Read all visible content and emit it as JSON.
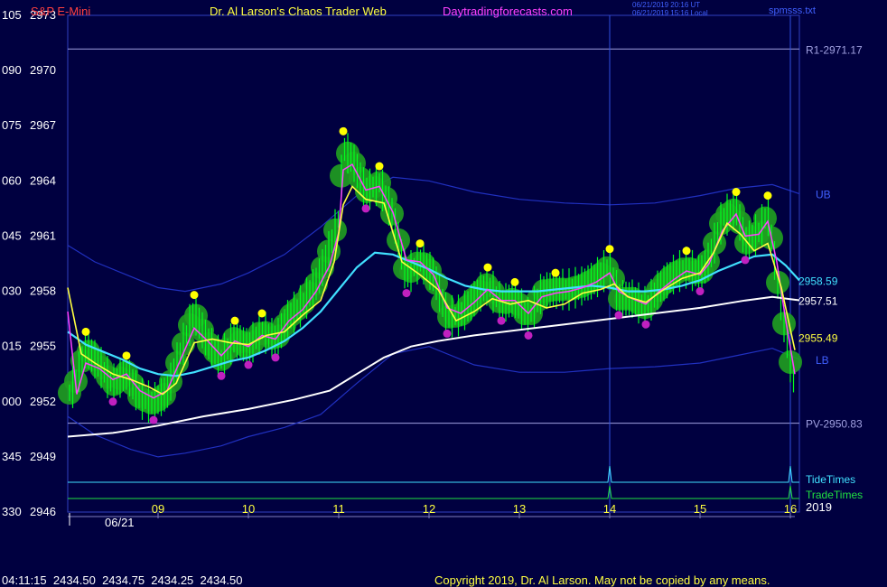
{
  "header": {
    "instrument": "S&P E-Mini",
    "site_title": "Dr. Al Larson's Chaos Trader Web",
    "site_url": "Daytradingforecasts.com",
    "timestamp_utc": "06/21/2019 20:16 UT",
    "timestamp_local": "06/21/2019 15:16 Local",
    "file_name": "spmsss.txt"
  },
  "footer": {
    "quote_line": "04:11:15  2434.50  2434.75  2434.25  2434.50",
    "copyright": "Copyright 2019, Dr. Al Larson. May not be copied by any means."
  },
  "chart_data": {
    "type": "line",
    "date_label": "06/21",
    "year_label": "2019",
    "x_ticks": [
      "09",
      "10",
      "11",
      "12",
      "13",
      "14",
      "15",
      "16"
    ],
    "y_ticks": [
      {
        "left": "105",
        "price": 2973
      },
      {
        "left": "090",
        "price": 2970
      },
      {
        "left": "075",
        "price": 2967
      },
      {
        "left": "060",
        "price": 2964
      },
      {
        "left": "045",
        "price": 2961
      },
      {
        "left": "030",
        "price": 2958
      },
      {
        "left": "015",
        "price": 2955
      },
      {
        "left": "000",
        "price": 2952
      },
      {
        "left": "345",
        "price": 2949
      },
      {
        "left": "330",
        "price": 2946
      }
    ],
    "ylim": [
      2946,
      2973
    ],
    "xlim": [
      8.0,
      16.1
    ],
    "levels": [
      {
        "label": "R1-2971.17",
        "value": 2971.17,
        "color": "#a0a0e0"
      },
      {
        "label": "PV-2950.83",
        "value": 2950.83,
        "color": "#a0a0e0"
      }
    ],
    "value_labels": [
      {
        "label": "2958.59",
        "value": 2958.59,
        "color": "#40e0ff"
      },
      {
        "label": "2957.51",
        "value": 2957.51,
        "color": "#ffffff"
      },
      {
        "label": "2955.49",
        "value": 2955.49,
        "color": "#ffff40"
      },
      {
        "label": "UB",
        "value": 2963.3,
        "color": "#4060ff"
      },
      {
        "label": "LB",
        "value": 2954.3,
        "color": "#4060ff"
      }
    ],
    "tide_times_label": "TideTimes",
    "trade_times_label": "TradeTimes",
    "time_markers": [
      14.0,
      16.0
    ],
    "colors": {
      "background": "#000040",
      "price_bars": "#00ff20",
      "glow": "#20a020",
      "avg_fast": "#ffff40",
      "avg_mid": "#ff40ff",
      "avg_cyan": "#40e0ff",
      "avg_white": "#ffffff",
      "bands": "#2030c0",
      "highs": "#ffff00",
      "lows": "#c020c0",
      "label_red": "#ff4040",
      "label_yellow": "#ffff40",
      "label_magenta": "#ff40ff"
    },
    "series": [
      {
        "name": "price",
        "x": [
          8.0,
          8.1,
          8.2,
          8.35,
          8.5,
          8.65,
          8.8,
          8.95,
          9.1,
          9.25,
          9.4,
          9.55,
          9.7,
          9.85,
          10.0,
          10.15,
          10.3,
          10.45,
          10.6,
          10.75,
          10.9,
          11.0,
          11.05,
          11.15,
          11.3,
          11.45,
          11.6,
          11.75,
          11.9,
          12.05,
          12.2,
          12.35,
          12.5,
          12.65,
          12.8,
          12.95,
          13.1,
          13.25,
          13.4,
          13.55,
          13.7,
          13.85,
          14.0,
          14.1,
          14.25,
          14.4,
          14.55,
          14.7,
          14.85,
          15.0,
          15.1,
          15.25,
          15.4,
          15.5,
          15.65,
          15.75,
          15.85,
          15.95,
          16.05
        ],
        "values": [
          2952.3,
          2953.2,
          2954.9,
          2954.0,
          2952.9,
          2953.6,
          2952.2,
          2951.9,
          2952.5,
          2954.7,
          2956.9,
          2955.2,
          2954.3,
          2955.5,
          2954.9,
          2955.9,
          2955.3,
          2956.6,
          2957.3,
          2958.4,
          2960.3,
          2962.0,
          2965.8,
          2965.2,
          2963.4,
          2963.9,
          2962.1,
          2958.8,
          2959.7,
          2958.9,
          2956.6,
          2956.7,
          2957.6,
          2958.4,
          2957.3,
          2957.6,
          2956.5,
          2958.0,
          2958.1,
          2958.1,
          2958.3,
          2958.7,
          2959.4,
          2957.6,
          2957.6,
          2957.1,
          2958.2,
          2958.9,
          2959.3,
          2958.9,
          2959.7,
          2962.0,
          2962.5,
          2960.6,
          2961.2,
          2962.3,
          2958.8,
          2955.6,
          2952.7
        ]
      },
      {
        "name": "avg_fast",
        "x": [
          8.0,
          8.15,
          8.3,
          8.5,
          8.7,
          8.9,
          9.05,
          9.2,
          9.4,
          9.6,
          9.8,
          10.0,
          10.2,
          10.4,
          10.6,
          10.8,
          10.95,
          11.05,
          11.15,
          11.3,
          11.5,
          11.7,
          11.9,
          12.1,
          12.3,
          12.5,
          12.7,
          12.9,
          13.1,
          13.3,
          13.5,
          13.7,
          13.9,
          14.05,
          14.2,
          14.4,
          14.6,
          14.8,
          15.0,
          15.15,
          15.3,
          15.45,
          15.6,
          15.75,
          15.9,
          16.05
        ],
        "values": [
          2958.2,
          2954.6,
          2954.1,
          2953.5,
          2953.2,
          2952.8,
          2952.4,
          2953.0,
          2955.2,
          2955.4,
          2955.2,
          2955.1,
          2955.6,
          2955.8,
          2956.7,
          2957.5,
          2959.6,
          2962.7,
          2963.7,
          2963.0,
          2962.8,
          2959.6,
          2958.9,
          2958.1,
          2956.4,
          2956.9,
          2957.6,
          2957.3,
          2957.5,
          2957.1,
          2957.3,
          2957.9,
          2958.1,
          2958.4,
          2957.7,
          2957.4,
          2958.1,
          2958.7,
          2959.0,
          2960.1,
          2961.7,
          2961.1,
          2960.2,
          2960.6,
          2958.2,
          2954.8
        ]
      },
      {
        "name": "avg_mid",
        "x": [
          8.0,
          8.1,
          8.2,
          8.35,
          8.5,
          8.65,
          8.8,
          8.95,
          9.1,
          9.25,
          9.4,
          9.55,
          9.7,
          9.85,
          10.0,
          10.15,
          10.3,
          10.45,
          10.6,
          10.75,
          10.9,
          11.0,
          11.05,
          11.15,
          11.3,
          11.45,
          11.6,
          11.75,
          11.9,
          12.05,
          12.2,
          12.35,
          12.5,
          12.65,
          12.8,
          12.95,
          13.1,
          13.25,
          13.4,
          13.55,
          13.7,
          13.85,
          14.0,
          14.1,
          14.25,
          14.4,
          14.55,
          14.7,
          14.85,
          15.0,
          15.1,
          15.25,
          15.4,
          15.5,
          15.65,
          15.75,
          15.85,
          15.95,
          16.05
        ],
        "values": [
          2956.9,
          2952.4,
          2954.1,
          2953.8,
          2953.2,
          2953.5,
          2952.6,
          2952.2,
          2952.6,
          2954.3,
          2956.0,
          2955.3,
          2954.5,
          2955.3,
          2955.0,
          2955.6,
          2955.4,
          2956.4,
          2957.0,
          2958.0,
          2959.4,
          2961.2,
          2964.6,
          2964.9,
          2963.5,
          2963.7,
          2962.3,
          2959.7,
          2959.6,
          2958.9,
          2957.1,
          2956.8,
          2957.4,
          2958.1,
          2957.5,
          2957.5,
          2956.8,
          2957.7,
          2957.9,
          2958.0,
          2958.2,
          2958.5,
          2959.0,
          2958.0,
          2957.6,
          2957.3,
          2958.0,
          2958.6,
          2959.1,
          2958.9,
          2959.5,
          2961.3,
          2962.2,
          2961.0,
          2961.1,
          2961.8,
          2959.6,
          2956.4,
          2953.5
        ]
      },
      {
        "name": "avg_cyan",
        "x": [
          8.0,
          8.2,
          8.4,
          8.6,
          8.8,
          9.0,
          9.2,
          9.4,
          9.6,
          9.8,
          10.0,
          10.2,
          10.4,
          10.6,
          10.8,
          11.0,
          11.2,
          11.4,
          11.6,
          11.8,
          12.0,
          12.2,
          12.4,
          12.6,
          12.8,
          13.0,
          13.2,
          13.4,
          13.6,
          13.8,
          14.0,
          14.2,
          14.4,
          14.6,
          14.8,
          15.0,
          15.2,
          15.4,
          15.6,
          15.8,
          15.95,
          16.1
        ],
        "values": [
          2955.8,
          2955.1,
          2954.7,
          2954.3,
          2953.8,
          2953.5,
          2953.4,
          2953.6,
          2953.9,
          2954.2,
          2954.4,
          2954.8,
          2955.3,
          2956.0,
          2956.9,
          2958.1,
          2959.3,
          2960.1,
          2960.0,
          2959.6,
          2959.2,
          2958.7,
          2958.3,
          2958.1,
          2958.0,
          2958.0,
          2958.0,
          2958.1,
          2958.2,
          2958.3,
          2958.2,
          2958.0,
          2958.0,
          2958.1,
          2958.3,
          2958.6,
          2959.1,
          2959.5,
          2959.9,
          2960.0,
          2959.4,
          2958.59
        ]
      },
      {
        "name": "avg_white",
        "x": [
          8.0,
          8.5,
          9.0,
          9.5,
          10.0,
          10.5,
          10.9,
          11.2,
          11.5,
          11.8,
          12.1,
          12.5,
          13.0,
          13.5,
          14.0,
          14.5,
          15.0,
          15.5,
          15.8,
          16.1
        ],
        "values": [
          2950.1,
          2950.3,
          2950.7,
          2951.2,
          2951.6,
          2952.1,
          2952.6,
          2953.5,
          2954.4,
          2955.0,
          2955.3,
          2955.6,
          2955.9,
          2956.2,
          2956.5,
          2956.8,
          2957.1,
          2957.5,
          2957.7,
          2957.51
        ]
      },
      {
        "name": "upper_band",
        "x": [
          8.0,
          8.3,
          8.7,
          9.0,
          9.3,
          9.7,
          10.0,
          10.4,
          10.8,
          11.2,
          11.6,
          12.0,
          12.5,
          13.0,
          13.5,
          14.0,
          14.5,
          15.0,
          15.4,
          15.8,
          16.1
        ],
        "values": [
          2960.5,
          2959.6,
          2958.8,
          2958.2,
          2958.0,
          2958.4,
          2959.0,
          2960.0,
          2961.5,
          2963.2,
          2964.2,
          2964.0,
          2963.4,
          2963.0,
          2962.8,
          2962.7,
          2962.8,
          2963.2,
          2963.6,
          2963.8,
          2963.3
        ]
      },
      {
        "name": "lower_band",
        "x": [
          8.0,
          8.3,
          8.7,
          9.0,
          9.3,
          9.7,
          10.0,
          10.4,
          10.8,
          11.2,
          11.6,
          12.0,
          12.5,
          13.0,
          13.5,
          14.0,
          14.5,
          15.0,
          15.4,
          15.8,
          16.1
        ],
        "values": [
          2951.2,
          2950.2,
          2949.4,
          2949.0,
          2949.2,
          2949.6,
          2950.1,
          2950.6,
          2951.3,
          2953.0,
          2954.6,
          2955.0,
          2954.0,
          2953.6,
          2953.6,
          2953.8,
          2953.9,
          2954.1,
          2954.5,
          2954.9,
          2954.3
        ]
      }
    ]
  }
}
